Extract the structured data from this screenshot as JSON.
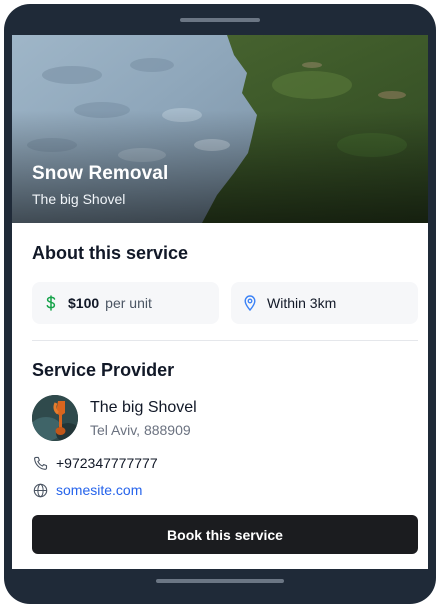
{
  "hero": {
    "title": "Snow Removal",
    "subtitle": "The big Shovel"
  },
  "about": {
    "heading": "About this service",
    "price": {
      "icon": "dollar-icon",
      "value": "$100",
      "unit": "per unit"
    },
    "distance": {
      "icon": "location-pin-icon",
      "label": "Within 3km"
    }
  },
  "provider": {
    "heading": "Service Provider",
    "name": "The big Shovel",
    "address": "Tel Aviv, 888909",
    "phone": "+972347777777",
    "website": "somesite.com"
  },
  "actions": {
    "book_label": "Book this service"
  },
  "colors": {
    "accent_link": "#2563eb",
    "price_icon": "#16a34a",
    "button_bg": "#1b1c1f",
    "device_frame": "#1f2a38"
  }
}
